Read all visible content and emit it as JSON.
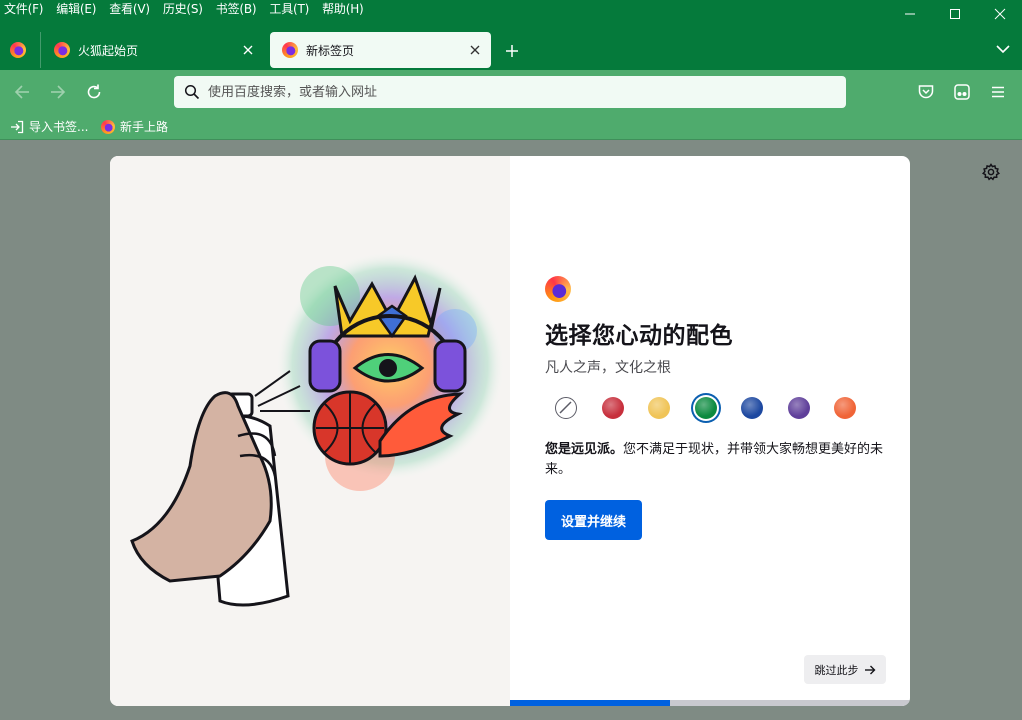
{
  "menu": [
    "文件(F)",
    "编辑(E)",
    "查看(V)",
    "历史(S)",
    "书签(B)",
    "工具(T)",
    "帮助(H)"
  ],
  "tabs": [
    {
      "label": "火狐起始页"
    },
    {
      "label": "新标签页"
    }
  ],
  "urlbar": {
    "placeholder": "使用百度搜索，或者输入网址"
  },
  "bookmarks": [
    {
      "label": "导入书签..."
    },
    {
      "label": "新手上路"
    }
  ],
  "onboarding": {
    "title": "选择您心动的配色",
    "subtitle": "凡人之声，文化之根",
    "colorways": [
      {
        "name": "default",
        "color": "none"
      },
      {
        "name": "red",
        "color": "#c72f3c"
      },
      {
        "name": "yellow",
        "color": "#f0c457"
      },
      {
        "name": "green",
        "color": "#0b8a3f"
      },
      {
        "name": "blue",
        "color": "#1d48a0"
      },
      {
        "name": "purple",
        "color": "#5f3f9a"
      },
      {
        "name": "orange",
        "color": "#f06437"
      }
    ],
    "selected_index": 3,
    "desc_bold": "您是远见派。",
    "desc_rest": "您不满足于现状，并带领大家畅想更美好的未来。",
    "primary_button": "设置并继续",
    "skip_button": "跳过此步",
    "progress": 0.4
  },
  "colors": {
    "titlebar": "#057a3b",
    "toolbar": "#4fab6d",
    "accent": "#0061e0",
    "page_bg": "#7f8b84"
  }
}
